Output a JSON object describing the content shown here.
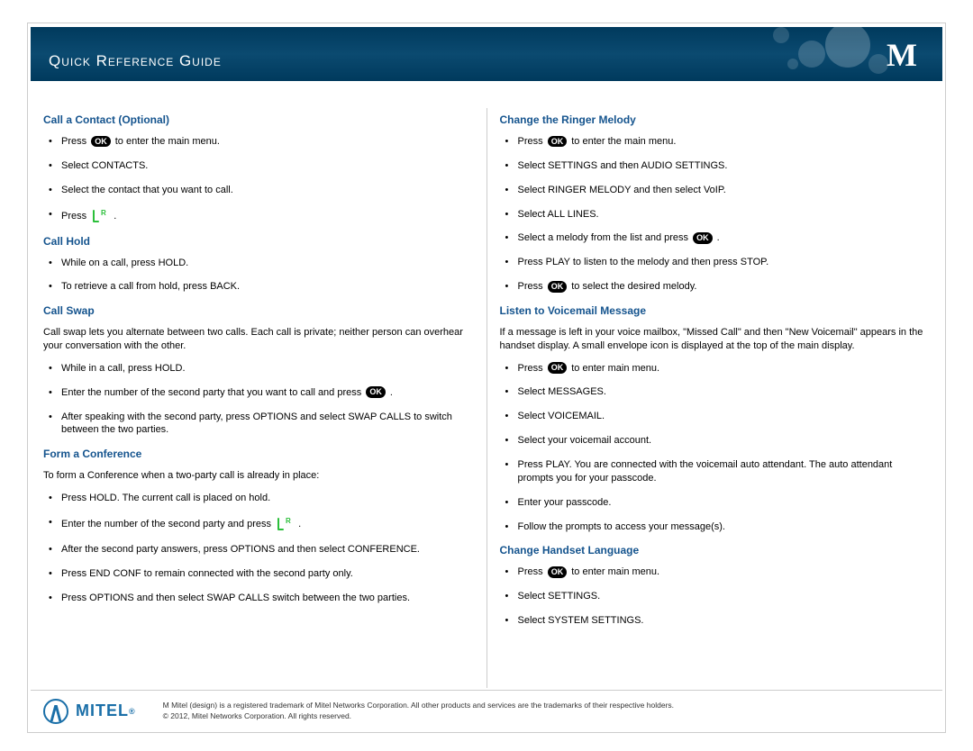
{
  "header": {
    "title": "Quick Reference Guide",
    "logo_letter": "M"
  },
  "left": {
    "s1": {
      "title": "Call a Contact (Optional)",
      "items": [
        {
          "pre": "Press ",
          "ok": true,
          "post": " to enter the main menu."
        },
        {
          "pre": "Select CONTACTS."
        },
        {
          "pre": "Select the contact that you want to call."
        },
        {
          "pre": "Press ",
          "call": true,
          "post": " ."
        }
      ]
    },
    "s2": {
      "title": "Call Hold",
      "items": [
        {
          "pre": "While on a call, press HOLD."
        },
        {
          "pre": "To retrieve a call from hold, press BACK."
        }
      ]
    },
    "s3": {
      "title": "Call Swap",
      "intro": "Call swap lets you alternate between two calls. Each call is private; neither person can overhear your conversation with the other.",
      "items": [
        {
          "pre": "While in a call, press HOLD."
        },
        {
          "pre": "Enter the number of the second party that you want to call and press ",
          "ok": true,
          "post": " ."
        },
        {
          "pre": "After speaking with the second party, press OPTIONS and select SWAP CALLS to switch between the two parties."
        }
      ]
    },
    "s4": {
      "title": "Form a Conference",
      "intro": "To form a Conference when a two-party call is already in place:",
      "items": [
        {
          "pre": "Press HOLD. The current call is placed on hold."
        },
        {
          "pre": "Enter the number of the second party and press ",
          "call": true,
          "post": " ."
        },
        {
          "pre": "After the second party answers, press OPTIONS and then select CONFERENCE."
        },
        {
          "pre": "Press END CONF to remain connected with the second party only."
        },
        {
          "pre": "Press OPTIONS and then select SWAP CALLS switch between the two parties."
        }
      ]
    }
  },
  "right": {
    "s1": {
      "title": "Change the Ringer Melody",
      "items": [
        {
          "pre": "Press ",
          "ok": true,
          "post": " to enter the main menu."
        },
        {
          "pre": "Select SETTINGS and then AUDIO SETTINGS."
        },
        {
          "pre": "Select RINGER MELODY and then select VoIP."
        },
        {
          "pre": "Select ALL LINES."
        },
        {
          "pre": "Select a melody from the list and press ",
          "ok": true,
          "post": " ."
        },
        {
          "pre": "Press PLAY to listen to the melody and then press STOP."
        },
        {
          "pre": "Press ",
          "ok": true,
          "post": " to select the desired melody."
        }
      ]
    },
    "s2": {
      "title": "Listen to Voicemail Message",
      "intro": "If a message is left in your voice mailbox, \"Missed Call\" and then \"New Voicemail\" appears in the handset display. A small envelope icon is displayed at the top of the main display.",
      "items": [
        {
          "pre": "Press ",
          "ok": true,
          "post": " to enter main menu."
        },
        {
          "pre": "Select MESSAGES."
        },
        {
          "pre": "Select VOICEMAIL."
        },
        {
          "pre": "Select your voicemail account."
        },
        {
          "pre": "Press PLAY. You are connected with the voicemail auto attendant. The auto attendant prompts you for your passcode."
        },
        {
          "pre": "Enter your passcode."
        },
        {
          "pre": "Follow the prompts to access your message(s)."
        }
      ]
    },
    "s3": {
      "title": "Change Handset Language",
      "items": [
        {
          "pre": "Press ",
          "ok": true,
          "post": " to enter main menu."
        },
        {
          "pre": "Select SETTINGS."
        },
        {
          "pre": "Select SYSTEM SETTINGS."
        }
      ]
    }
  },
  "footer": {
    "brand": "MITEL",
    "legal1": "M Mitel (design) is a registered trademark of Mitel Networks Corporation. All other products and services are the trademarks of their respective holders.",
    "legal2": "© 2012, Mitel Networks Corporation. All rights reserved."
  },
  "icons": {
    "ok_label": "OK"
  }
}
